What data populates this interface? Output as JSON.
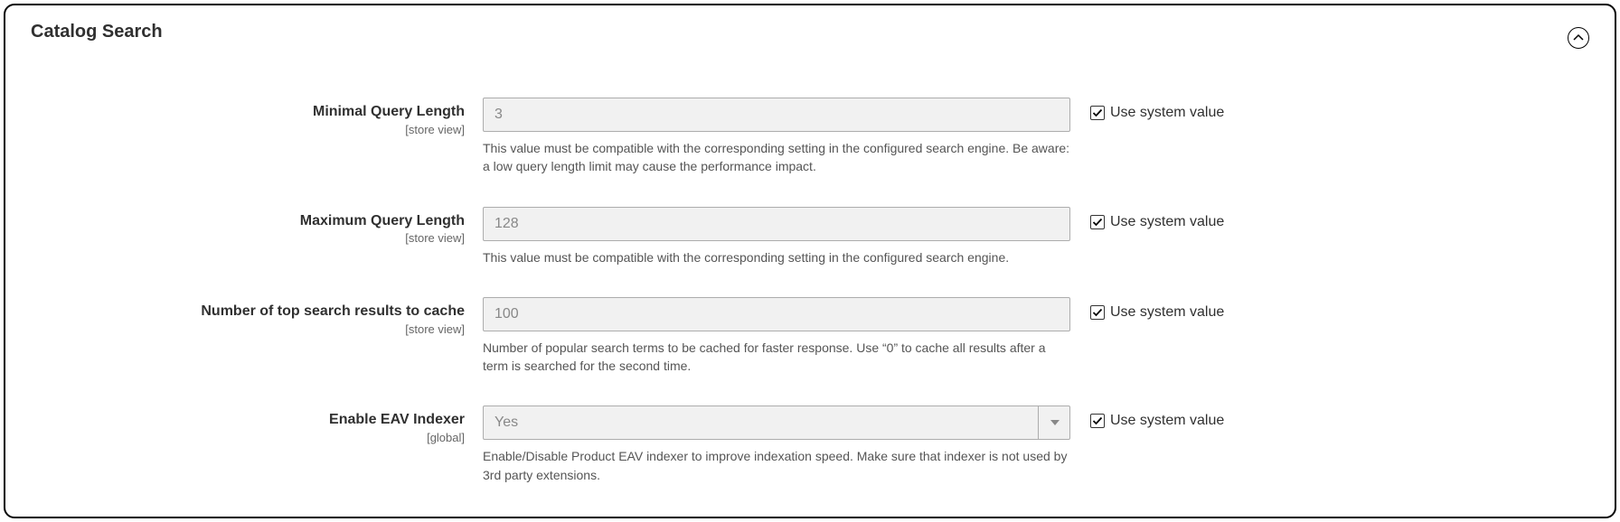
{
  "panel": {
    "title": "Catalog Search"
  },
  "fields": {
    "min_query": {
      "label": "Minimal Query Length",
      "scope": "[store view]",
      "value": "3",
      "help": "This value must be compatible with the corresponding setting in the configured search engine. Be aware: a low query length limit may cause the performance impact.",
      "use_system_label": "Use system value"
    },
    "max_query": {
      "label": "Maximum Query Length",
      "scope": "[store view]",
      "value": "128",
      "help": "This value must be compatible with the corresponding setting in the configured search engine.",
      "use_system_label": "Use system value"
    },
    "top_results": {
      "label": "Number of top search results to cache",
      "scope": "[store view]",
      "value": "100",
      "help": "Number of popular search terms to be cached for faster response. Use “0” to cache all results after a term is searched for the second time.",
      "use_system_label": "Use system value"
    },
    "eav_indexer": {
      "label": "Enable EAV Indexer",
      "scope": "[global]",
      "value": "Yes",
      "help": "Enable/Disable Product EAV indexer to improve indexation speed. Make sure that indexer is not used by 3rd party extensions.",
      "use_system_label": "Use system value"
    }
  }
}
